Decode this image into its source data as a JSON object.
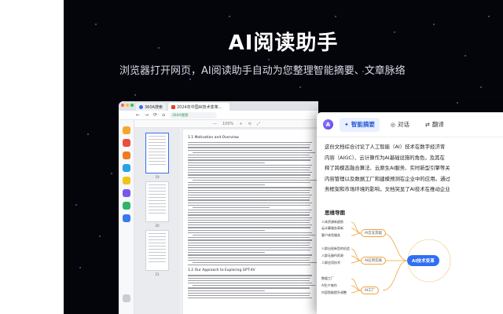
{
  "promo": {
    "headline": "AI阅读助手",
    "subline": "浏览器打开网页，AI阅读助手自动为您整理智能摘要、文章脉络"
  },
  "browser": {
    "tabs": [
      {
        "label": "360A搜索",
        "active": false
      },
      {
        "label": "2024年中国AI技术变革...",
        "active": true
      }
    ],
    "url": "360A搜索",
    "pdf_toolbar": [
      "—",
      "100%",
      "+",
      "⟲",
      "⤢"
    ],
    "thumb_pages": [
      "19",
      "20",
      "21"
    ],
    "doc": {
      "section_1": "1.1    Motivation and Overview",
      "section_2": "1.2    Our Approach to Exploring GPT-4V"
    }
  },
  "panel": {
    "logo": "A",
    "tabs": [
      {
        "icon": "✦",
        "label": "智能摘要",
        "active": true
      },
      {
        "icon": "◎",
        "label": "对话",
        "active": false
      },
      {
        "icon": "⇄",
        "label": "翻译",
        "active": false
      }
    ],
    "summary_lines": [
      "这份文档综合讨论了人工智能（AI）技术在数字经济背",
      "内容（AIGC）、云计算作为AI基础设施的角色，及其在",
      "释了跨模态融合算法、云原生AI服务、实时新型引擎等关",
      "内容管理以及数据工厂和建模预测在企业中的应用。通过",
      "务框架和市场环境的影响，文档突显了AI技术在推动企业"
    ],
    "mindmap_title": "思维导图",
    "mindmap": {
      "root": "AI技术变革",
      "branches": [
        "AI云支其础",
        "AI应用实践",
        "AI工厂"
      ],
      "leaves": [
        "人体资源新趋势",
        "云计算服务革新",
        "客户体验服务",
        "人群出现新型的机会",
        "人群无服AI资源",
        "人群应用技术",
        "数据工厂",
        "AI生产制作",
        "内容智能提升调整"
      ]
    }
  }
}
